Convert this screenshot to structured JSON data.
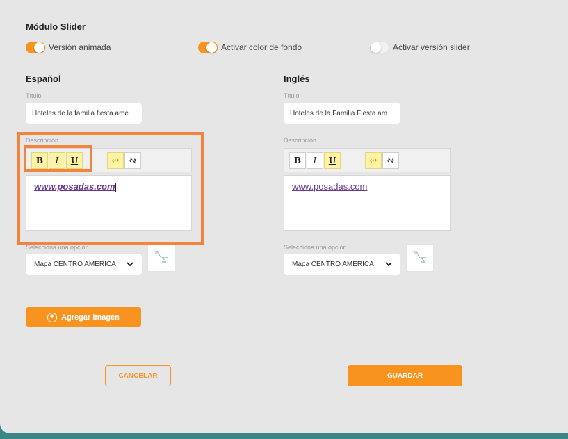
{
  "module": {
    "title": "Módulo Slider"
  },
  "toggles": [
    {
      "label": "Versión animada",
      "on": true
    },
    {
      "label": "Activar color de fondo",
      "on": true
    },
    {
      "label": "Activar versión slider",
      "on": false
    }
  ],
  "spanish": {
    "heading": "Español",
    "title_label": "Título",
    "title_value": "Hoteles de la familia fiesta ame",
    "description_label": "Descripción",
    "description_link": "www.posadas.com",
    "select_label": "Selecciona una opción",
    "select_value": "Mapa CENTRO AMERICA"
  },
  "english": {
    "heading": "Inglés",
    "title_label": "Título",
    "title_value": "Hoteles de la Familia Fiesta am",
    "description_label": "Descripción",
    "description_link": "www.posadas.com",
    "select_label": "Selecciona una opción",
    "select_value": "Mapa CENTRO AMERICA"
  },
  "toolbar": {
    "bold": "B",
    "italic": "I",
    "underline": "U"
  },
  "actions": {
    "add_image": "Agregar imagen",
    "cancel": "CANCELAR",
    "save": "GUARDAR"
  },
  "colors": {
    "accent": "#f7931e",
    "highlight": "#f4833f",
    "link": "#6a3a93",
    "footer": "#3a8587"
  }
}
